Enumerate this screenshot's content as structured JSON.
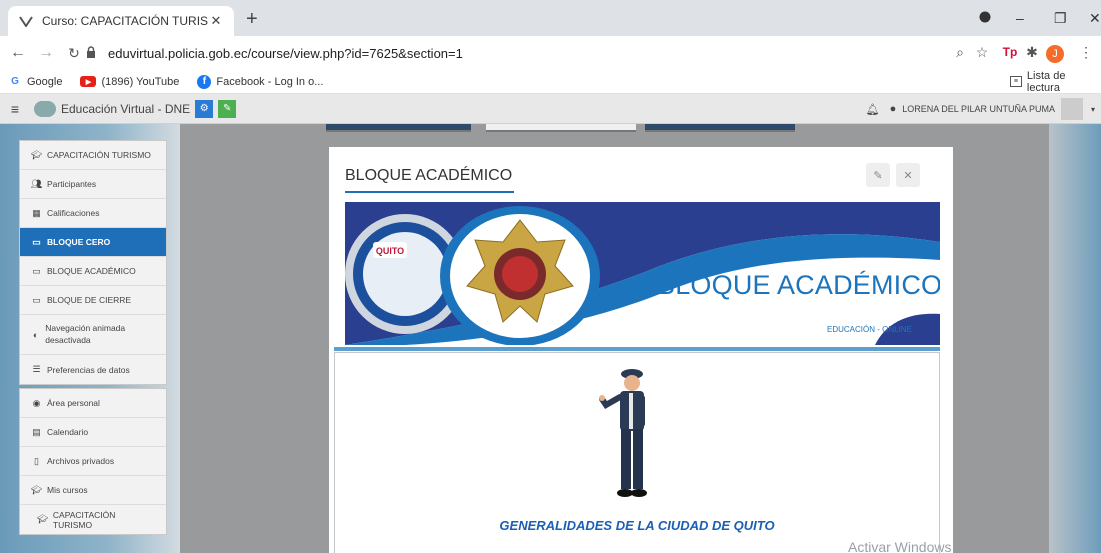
{
  "browser": {
    "tab_title": "Curso: CAPACITACIÓN TURISMO",
    "url": "eduvirtual.policia.gob.ec/course/view.php?id=7625&section=1",
    "bookmarks": [
      {
        "label": "Google",
        "icon": "google-icon"
      },
      {
        "label": "(1896) YouTube",
        "icon": "youtube-icon"
      },
      {
        "label": "Facebook - Log In o...",
        "icon": "facebook-icon"
      }
    ],
    "reading_list": "Lista de lectura",
    "profile_initial": "J",
    "ext_label": "Tp"
  },
  "moodle": {
    "brand": "Educación Virtual - DNE",
    "user": "LORENA DEL PILAR UNTUÑA PUMA"
  },
  "sidebar": {
    "group1": [
      {
        "label": "CAPACITACIÓN TURISMO",
        "icon": "graduation-cap-icon"
      },
      {
        "label": "Participantes",
        "icon": "users-icon"
      },
      {
        "label": "Calificaciones",
        "icon": "table-icon"
      },
      {
        "label": "BLOQUE CERO",
        "icon": "folder-icon"
      },
      {
        "label": "BLOQUE ACADÉMICO",
        "icon": "folder-icon"
      },
      {
        "label": "BLOQUE DE CIERRE",
        "icon": "folder-icon"
      },
      {
        "label": "Navegación animada desactivada",
        "icon": "toggle-icon"
      },
      {
        "label": "Preferencias de datos",
        "icon": "database-icon"
      }
    ],
    "group2": [
      {
        "label": "Área personal",
        "icon": "dashboard-icon"
      },
      {
        "label": "Calendario",
        "icon": "calendar-icon"
      },
      {
        "label": "Archivos privados",
        "icon": "file-icon"
      },
      {
        "label": "Mis cursos",
        "icon": "graduation-cap-icon"
      },
      {
        "label": "CAPACITACIÓN TURISMO",
        "icon": "graduation-cap-icon"
      }
    ]
  },
  "modal": {
    "title": "BLOQUE ACADÉMICO",
    "banner_title": "BLOQUE ACADÉMICO",
    "banner_subtitle": "EDUCACIÓN - ONLINE",
    "logo_text": "QUITO",
    "content_title": "GENERALIDADES DE LA CIUDAD DE QUITO"
  },
  "watermark": "Activar Windows",
  "colors": {
    "active": "#1e6fb8",
    "banner_blue": "#1c75bc"
  }
}
